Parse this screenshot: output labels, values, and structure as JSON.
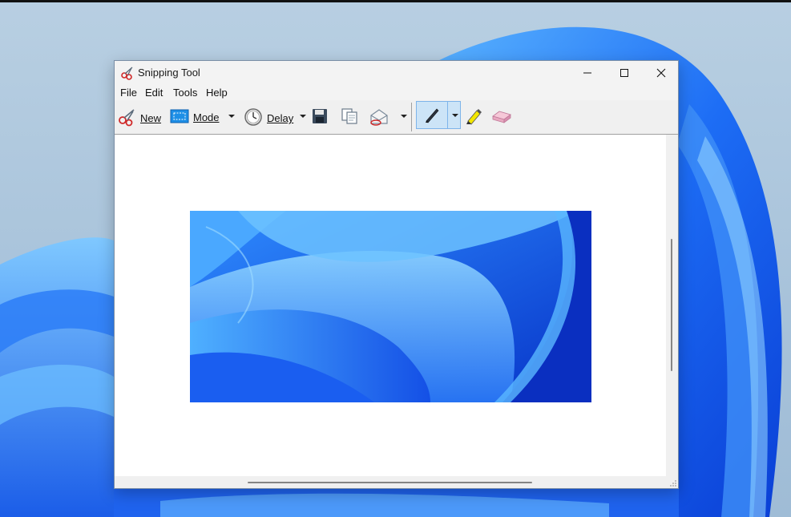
{
  "window": {
    "title": "Snipping Tool"
  },
  "menu": {
    "items": [
      "File",
      "Edit",
      "Tools",
      "Help"
    ]
  },
  "toolbar": {
    "new_label": "New",
    "mode_label": "Mode",
    "delay_label": "Delay"
  },
  "icons": {
    "app": "scissors-icon",
    "new": "scissors-icon",
    "mode": "rectangle-snip-icon",
    "delay": "clock-icon",
    "save": "floppy-disk-icon",
    "copy": "copy-icon",
    "send": "envelope-icon",
    "pen": "pen-icon",
    "highlighter": "highlighter-icon",
    "eraser": "eraser-icon"
  },
  "colors": {
    "accent_selected": "#cce4f7",
    "wallpaper_blue": "#1a5cf0"
  }
}
